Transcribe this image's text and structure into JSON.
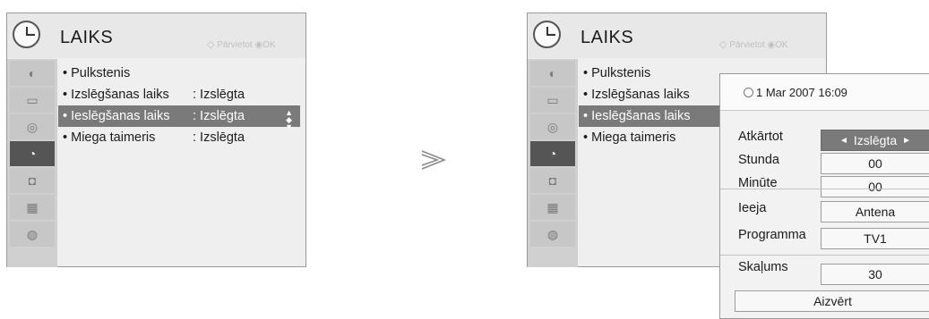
{
  "menu": {
    "title": "LAIKS",
    "hint": "Pārvietot",
    "ok": "OK",
    "side_icons": [
      "picture-icon",
      "screen-icon",
      "audio-icon",
      "time-icon",
      "lock-icon",
      "option-icon",
      "globe-icon"
    ],
    "selected_icon_index": 3,
    "items": [
      {
        "label": "Pulkstenis",
        "value": ""
      },
      {
        "label": "Izslēgšanas laiks",
        "value": ": Izslēgta"
      },
      {
        "label": "Ieslēgšanas laiks",
        "value": ": Izslēgta"
      },
      {
        "label": "Miega taimeris",
        "value": ": Izslēgta"
      }
    ],
    "selected_item_index": 2
  },
  "popup": {
    "datetime": "1 Mar 2007 16:09",
    "fields": [
      {
        "label": "Atkārtot",
        "value": "Izslēgta",
        "selected": true
      },
      {
        "label": "Stunda",
        "value": "00"
      },
      {
        "label": "Minūte",
        "value": "00"
      },
      {
        "label": "Ieeja",
        "value": "Antena"
      },
      {
        "label": "Programma",
        "value": "TV1"
      },
      {
        "label": "Skaļums",
        "value": "30"
      }
    ],
    "close_label": "Aizvērt"
  },
  "colors": {
    "panel_bg": "#efefef",
    "highlight": "#7a7a7a",
    "sidebar": "#d0d0d0",
    "selected_icon": "#555555"
  }
}
